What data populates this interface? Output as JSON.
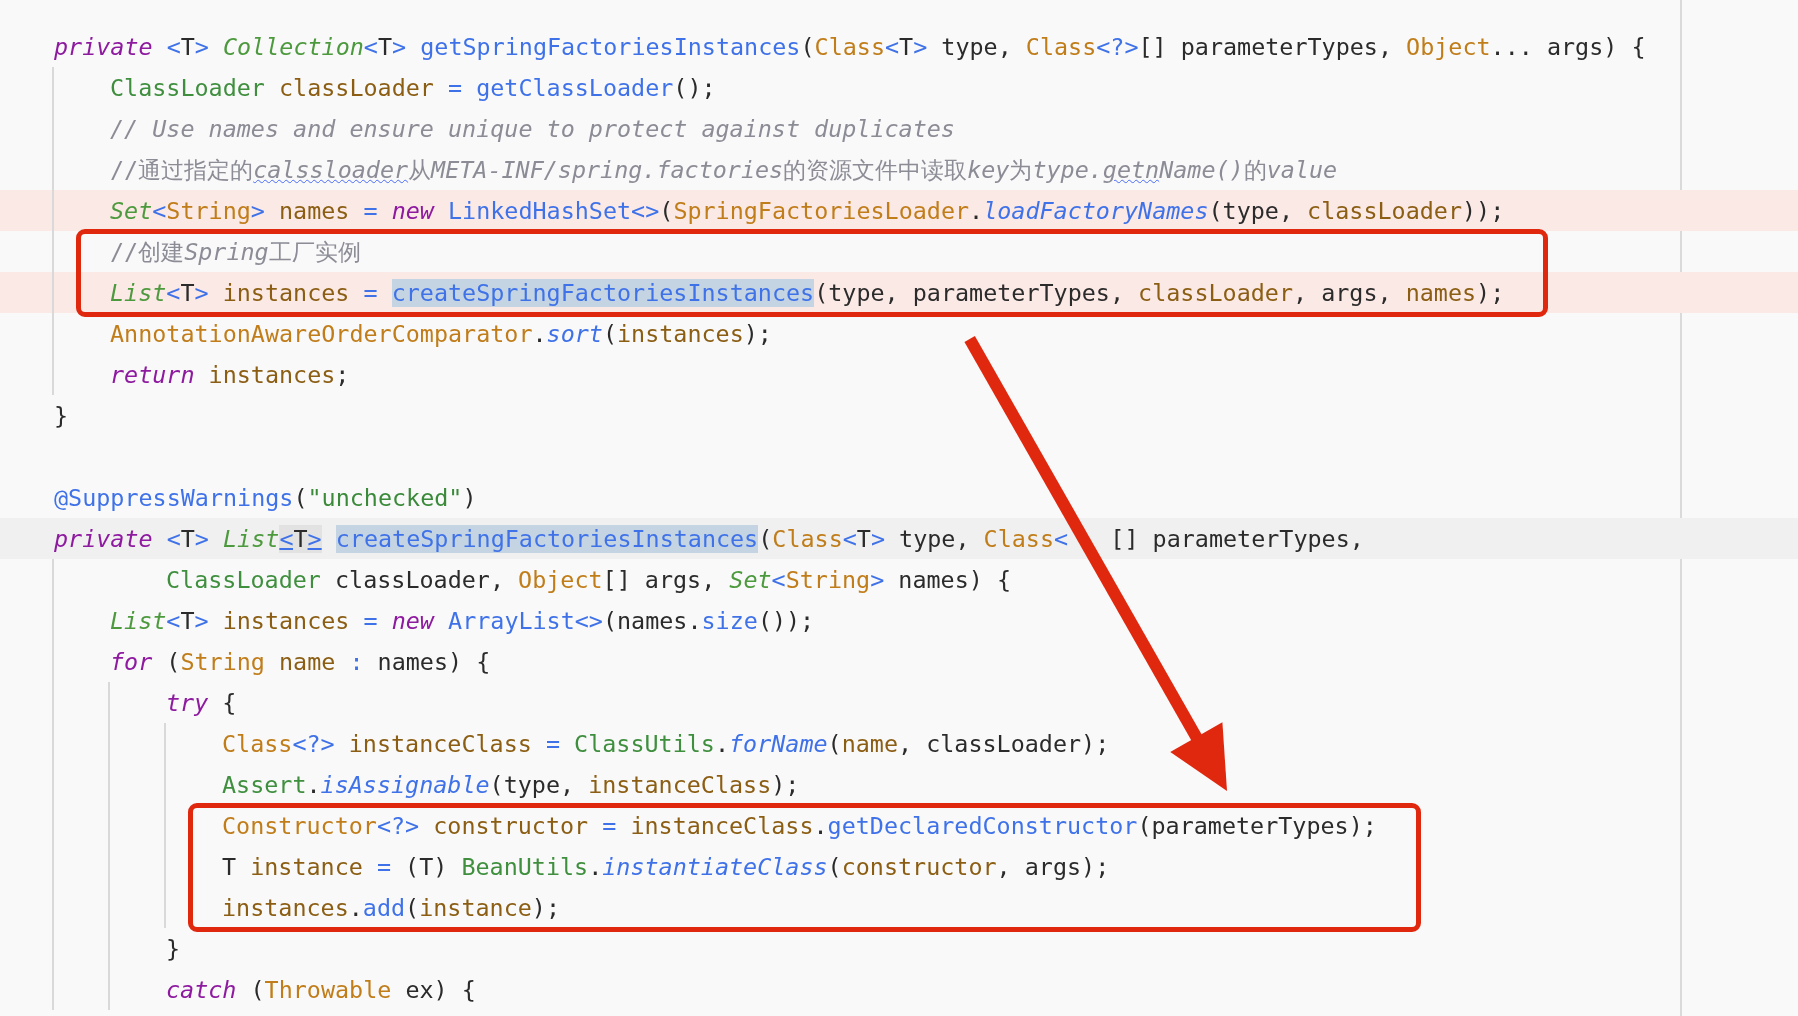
{
  "lines": [
    {
      "tokens": [
        {
          "text": "private ",
          "kind": "keyword"
        },
        {
          "text": "<",
          "kind": "call"
        },
        {
          "text": "T",
          "kind": "plain"
        },
        {
          "text": "> ",
          "kind": "call"
        },
        {
          "text": "Collection",
          "kind": "generic"
        },
        {
          "text": "<",
          "kind": "call"
        },
        {
          "text": "T",
          "kind": "plain"
        },
        {
          "text": "> ",
          "kind": "call"
        },
        {
          "text": "getSpringFactoriesInstances",
          "kind": "call"
        },
        {
          "text": "(",
          "kind": "plain"
        },
        {
          "text": "Class",
          "kind": "typeref"
        },
        {
          "text": "<",
          "kind": "call"
        },
        {
          "text": "T",
          "kind": "plain"
        },
        {
          "text": ">",
          "kind": "call"
        },
        {
          "text": " type, ",
          "kind": "plain"
        },
        {
          "text": "Class",
          "kind": "typeref"
        },
        {
          "text": "<?>",
          "kind": "call"
        },
        {
          "text": "[] parameterTypes, ",
          "kind": "plain"
        },
        {
          "text": "Object",
          "kind": "typeref"
        },
        {
          "text": "... args) {",
          "kind": "plain"
        }
      ],
      "children": [
        {
          "tokens": [
            {
              "text": "ClassLoader ",
              "kind": "classref"
            },
            {
              "text": "classLoader ",
              "kind": "local"
            },
            {
              "text": "= ",
              "kind": "call"
            },
            {
              "text": "getClassLoader",
              "kind": "call"
            },
            {
              "text": "();",
              "kind": "plain"
            }
          ]
        },
        {
          "tokens": [
            {
              "text": "// Use names and ensure unique to protect against duplicates",
              "kind": "comment"
            }
          ]
        },
        {
          "tokens": [
            {
              "text": "//通过指定的",
              "kind": "note"
            },
            {
              "text": "calssloader",
              "kind": "typo"
            },
            {
              "text": "从",
              "kind": "note"
            },
            {
              "text": "META-INF/spring.factories",
              "kind": "comment"
            },
            {
              "text": "的资源文件中读取",
              "kind": "note"
            },
            {
              "text": "key",
              "kind": "comment"
            },
            {
              "text": "为",
              "kind": "note"
            },
            {
              "text": "type.",
              "kind": "comment"
            },
            {
              "text": "getn",
              "kind": "typo"
            },
            {
              "text": "Name()",
              "kind": "comment"
            },
            {
              "text": "的",
              "kind": "note"
            },
            {
              "text": "value",
              "kind": "comment"
            }
          ]
        },
        {
          "flagged": true,
          "tokens": [
            {
              "text": "Set",
              "kind": "generic"
            },
            {
              "text": "<",
              "kind": "call"
            },
            {
              "text": "String",
              "kind": "typeref"
            },
            {
              "text": "> ",
              "kind": "call"
            },
            {
              "text": "names ",
              "kind": "local"
            },
            {
              "text": "= ",
              "kind": "call"
            },
            {
              "text": "new ",
              "kind": "keyword"
            },
            {
              "text": "LinkedHashSet<>",
              "kind": "call"
            },
            {
              "text": "(",
              "kind": "plain"
            },
            {
              "text": "SpringFactoriesLoader",
              "kind": "typeref"
            },
            {
              "text": ".",
              "kind": "plain"
            },
            {
              "text": "loadFactoryNames",
              "kind": "static"
            },
            {
              "text": "(type, ",
              "kind": "plain"
            },
            {
              "text": "classLoader",
              "kind": "local"
            },
            {
              "text": "));",
              "kind": "plain"
            }
          ]
        },
        {
          "boxed": true,
          "tokens": [
            {
              "text": "//创建",
              "kind": "note"
            },
            {
              "text": "Spring",
              "kind": "comment"
            },
            {
              "text": "工厂实例",
              "kind": "note"
            }
          ]
        },
        {
          "boxed": true,
          "flagged": true,
          "tokens": [
            {
              "text": "List",
              "kind": "generic"
            },
            {
              "text": "<",
              "kind": "call"
            },
            {
              "text": "T",
              "kind": "plain"
            },
            {
              "text": "> ",
              "kind": "call"
            },
            {
              "text": "instances ",
              "kind": "local"
            },
            {
              "text": "= ",
              "kind": "call"
            },
            {
              "text": "createSpringFactoriesInstances",
              "kind": "selected"
            },
            {
              "text": "(type, parameterTypes, ",
              "kind": "plain"
            },
            {
              "text": "classLoader",
              "kind": "local"
            },
            {
              "text": ", args, ",
              "kind": "plain"
            },
            {
              "text": "names",
              "kind": "local"
            },
            {
              "text": ");",
              "kind": "plain"
            }
          ]
        },
        {
          "tokens": [
            {
              "text": "AnnotationAwareOrderComparator",
              "kind": "typeref"
            },
            {
              "text": ".",
              "kind": "plain"
            },
            {
              "text": "sort",
              "kind": "static"
            },
            {
              "text": "(",
              "kind": "plain"
            },
            {
              "text": "instances",
              "kind": "local"
            },
            {
              "text": ");",
              "kind": "plain"
            }
          ]
        },
        {
          "tokens": [
            {
              "text": "return ",
              "kind": "keyword"
            },
            {
              "text": "instances",
              "kind": "local"
            },
            {
              "text": ";",
              "kind": "plain"
            }
          ]
        }
      ]
    },
    {
      "gap_after": true,
      "tokens": [
        {
          "text": "}",
          "kind": "plain"
        }
      ]
    },
    {
      "tokens": [
        {
          "text": "@SuppressWarnings",
          "kind": "call"
        },
        {
          "text": "(",
          "kind": "plain"
        },
        {
          "text": "\"unchecked\"",
          "kind": "literal"
        },
        {
          "text": ")",
          "kind": "plain"
        }
      ]
    },
    {
      "current": true,
      "tokens": [
        {
          "text": "private ",
          "kind": "keyword"
        },
        {
          "text": "<",
          "kind": "call"
        },
        {
          "text": "T",
          "kind": "plain"
        },
        {
          "text": "> ",
          "kind": "call"
        },
        {
          "text": "List",
          "kind": "generic"
        },
        {
          "text": "<",
          "kind": "brace"
        },
        {
          "text": "T",
          "kind": "braced"
        },
        {
          "text": ">",
          "kind": "closer"
        },
        {
          "text": "createSpringFactoriesInstances",
          "kind": "selected"
        },
        {
          "text": "(",
          "kind": "plain"
        },
        {
          "text": "Class",
          "kind": "typeref"
        },
        {
          "text": "<",
          "kind": "call"
        },
        {
          "text": "T",
          "kind": "plain"
        },
        {
          "text": ">",
          "kind": "call"
        },
        {
          "text": " type, ",
          "kind": "plain"
        },
        {
          "text": "Class",
          "kind": "typeref"
        },
        {
          "text": "<",
          "kind": "call"
        },
        {
          "text": "   [] parameterTypes,",
          "kind": "plain"
        }
      ],
      "children": [
        {
          "kind": "continuation",
          "tokens": [
            {
              "text": "ClassLoader",
              "kind": "classref"
            },
            {
              "text": " classLoader, ",
              "kind": "plain"
            },
            {
              "text": "Object",
              "kind": "typeref"
            },
            {
              "text": "[] args, ",
              "kind": "plain"
            },
            {
              "text": "Set",
              "kind": "generic"
            },
            {
              "text": "<",
              "kind": "call"
            },
            {
              "text": "String",
              "kind": "typeref"
            },
            {
              "text": ">",
              "kind": "call"
            },
            {
              "text": " names) {",
              "kind": "plain"
            }
          ]
        },
        {
          "tokens": [
            {
              "text": "List",
              "kind": "generic"
            },
            {
              "text": "<",
              "kind": "call"
            },
            {
              "text": "T",
              "kind": "plain"
            },
            {
              "text": "> ",
              "kind": "call"
            },
            {
              "text": "instances ",
              "kind": "local"
            },
            {
              "text": "= ",
              "kind": "call"
            },
            {
              "text": "new ",
              "kind": "keyword"
            },
            {
              "text": "ArrayList<>",
              "kind": "call"
            },
            {
              "text": "(names.",
              "kind": "plain"
            },
            {
              "text": "size",
              "kind": "call"
            },
            {
              "text": "());",
              "kind": "plain"
            }
          ]
        },
        {
          "tokens": [
            {
              "text": "for",
              "kind": "keyword"
            },
            {
              "text": " (",
              "kind": "plain"
            },
            {
              "text": "String ",
              "kind": "typeref"
            },
            {
              "text": "name ",
              "kind": "local"
            },
            {
              "text": ":",
              "kind": "call"
            },
            {
              "text": " names) {",
              "kind": "plain"
            }
          ],
          "children": [
            {
              "tokens": [
                {
                  "text": "try",
                  "kind": "keyword"
                },
                {
                  "text": " {",
                  "kind": "plain"
                }
              ],
              "children": [
                {
                  "tokens": [
                    {
                      "text": "Class",
                      "kind": "typeref"
                    },
                    {
                      "text": "<?> ",
                      "kind": "call"
                    },
                    {
                      "text": "instanceClass ",
                      "kind": "local"
                    },
                    {
                      "text": "= ",
                      "kind": "call"
                    },
                    {
                      "text": "ClassUtils",
                      "kind": "classref"
                    },
                    {
                      "text": ".",
                      "kind": "plain"
                    },
                    {
                      "text": "forName",
                      "kind": "static"
                    },
                    {
                      "text": "(",
                      "kind": "plain"
                    },
                    {
                      "text": "name",
                      "kind": "local"
                    },
                    {
                      "text": ", classLoader);",
                      "kind": "plain"
                    }
                  ]
                },
                {
                  "tokens": [
                    {
                      "text": "Assert",
                      "kind": "classref"
                    },
                    {
                      "text": ".",
                      "kind": "plain"
                    },
                    {
                      "text": "isAssignable",
                      "kind": "static"
                    },
                    {
                      "text": "(type, ",
                      "kind": "plain"
                    },
                    {
                      "text": "instanceClass",
                      "kind": "local"
                    },
                    {
                      "text": ");",
                      "kind": "plain"
                    }
                  ]
                },
                {
                  "boxed": true,
                  "tokens": [
                    {
                      "text": "Constructor",
                      "kind": "typeref"
                    },
                    {
                      "text": "<?> ",
                      "kind": "call"
                    },
                    {
                      "text": "constructor ",
                      "kind": "local"
                    },
                    {
                      "text": "= ",
                      "kind": "call"
                    },
                    {
                      "text": "instanceClass",
                      "kind": "local"
                    },
                    {
                      "text": ".",
                      "kind": "plain"
                    },
                    {
                      "text": "getDeclaredConstructor",
                      "kind": "call"
                    },
                    {
                      "text": "(parameterTypes);",
                      "kind": "plain"
                    }
                  ]
                },
                {
                  "boxed": true,
                  "tokens": [
                    {
                      "text": "T ",
                      "kind": "plain"
                    },
                    {
                      "text": "instance ",
                      "kind": "local"
                    },
                    {
                      "text": "=",
                      "kind": "call"
                    },
                    {
                      "text": " (T) ",
                      "kind": "plain"
                    },
                    {
                      "text": "BeanUtils",
                      "kind": "classref"
                    },
                    {
                      "text": ".",
                      "kind": "plain"
                    },
                    {
                      "text": "instantiateClass",
                      "kind": "static"
                    },
                    {
                      "text": "(",
                      "kind": "plain"
                    },
                    {
                      "text": "constructor",
                      "kind": "local"
                    },
                    {
                      "text": ", args);",
                      "kind": "plain"
                    }
                  ]
                },
                {
                  "boxed": true,
                  "tokens": [
                    {
                      "text": "instances",
                      "kind": "local"
                    },
                    {
                      "text": ".",
                      "kind": "plain"
                    },
                    {
                      "text": "add",
                      "kind": "call"
                    },
                    {
                      "text": "(",
                      "kind": "plain"
                    },
                    {
                      "text": "instance",
                      "kind": "local"
                    },
                    {
                      "text": ");",
                      "kind": "plain"
                    }
                  ]
                }
              ]
            },
            {
              "tokens": [
                {
                  "text": "}",
                  "kind": "plain"
                }
              ]
            },
            {
              "tokens": [
                {
                  "text": "catch",
                  "kind": "keyword"
                },
                {
                  "text": " (",
                  "kind": "plain"
                },
                {
                  "text": "Throwable",
                  "kind": "typeref"
                },
                {
                  "text": " ex) {",
                  "kind": "plain"
                }
              ]
            }
          ]
        }
      ]
    }
  ],
  "arrow": true
}
